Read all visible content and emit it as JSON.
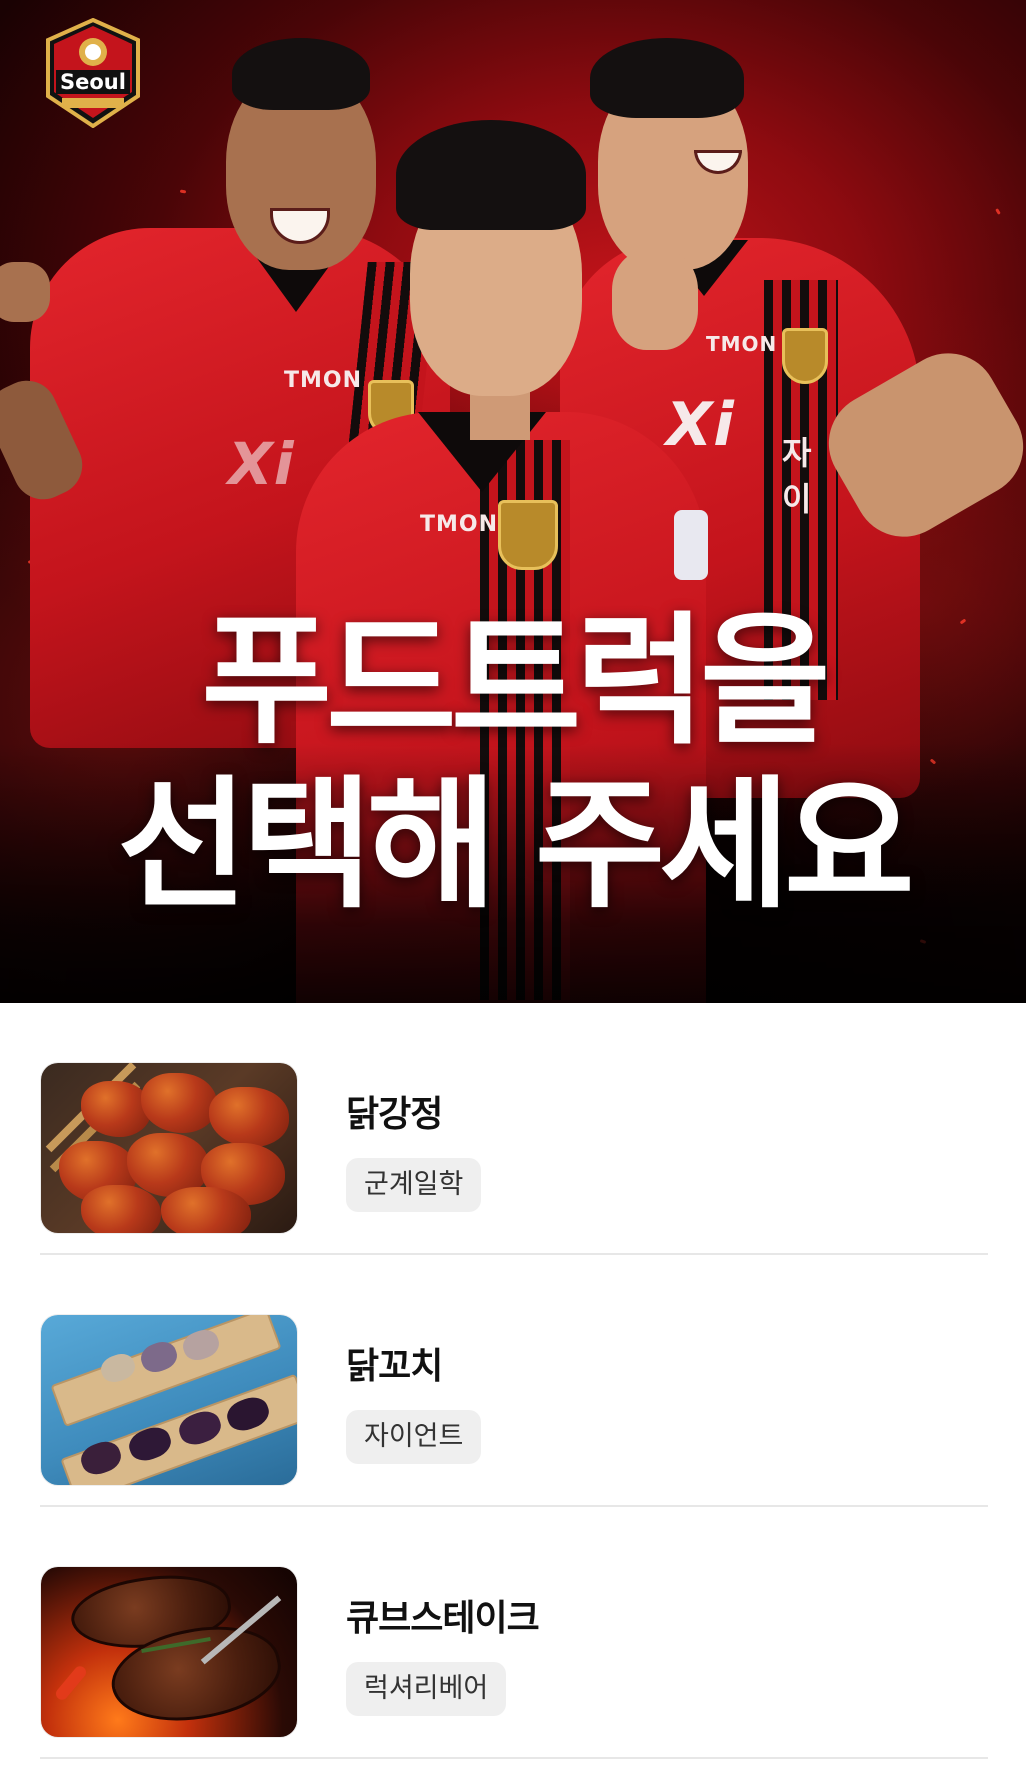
{
  "hero": {
    "logo_text": "Seoul",
    "title_line1": "푸드트럭을",
    "title_line2": "선택해 주세요",
    "sponsor_left": "TMON",
    "sponsor_center": "TMON",
    "sponsor_right": "TMON",
    "sponsor_xi": "Xi",
    "sponsor_xi_kr": "자이",
    "crest_text": "Seoul"
  },
  "trucks": [
    {
      "name": "닭강정",
      "vendor": "군계일학",
      "image": "sweet-crispy-chicken-photo"
    },
    {
      "name": "닭꼬치",
      "vendor": "자이언트",
      "image": "chicken-skewer-photo"
    },
    {
      "name": "큐브스테이크",
      "vendor": "럭셔리베어",
      "image": "cube-steak-photo"
    }
  ],
  "colors": {
    "brand_red": "#c4141c",
    "tag_bg": "#efefef",
    "divider": "#e7e7e7"
  }
}
